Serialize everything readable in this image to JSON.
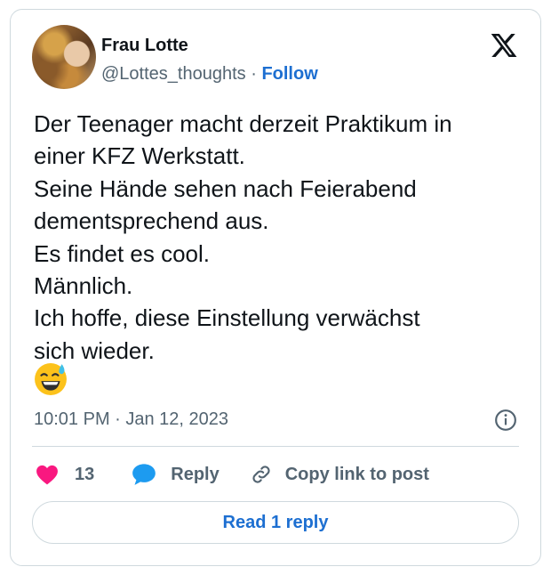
{
  "author": {
    "name": "Frau Lotte",
    "handle": "@Lottes_thoughts",
    "separator": "·",
    "follow_label": "Follow"
  },
  "tweet": {
    "text": "Der Teenager macht derzeit Praktikum in\neiner KFZ Werkstatt.\nSeine Hände sehen nach Feierabend\ndementsprechend aus.\nEs findet es cool.\nMännlich.\nIch hoffe, diese Einstellung verwächst\nsich wieder.",
    "emoji": "sweat-smile-emoji",
    "timestamp": "10:01 PM · Jan 12, 2023"
  },
  "actions": {
    "likes_count": "13",
    "reply_label": "Reply",
    "copy_link_label": "Copy link to post",
    "read_reply_label": "Read 1 reply"
  },
  "icons": {
    "logo": "x-logo-icon",
    "info": "info-icon",
    "like": "heart-icon",
    "reply": "speech-bubble-icon",
    "copy": "link-icon"
  },
  "colors": {
    "accent": "#1d6fd1",
    "like": "#f91880",
    "reply": "#1d9bf0",
    "muted": "#536471",
    "border": "#cfd9de"
  }
}
